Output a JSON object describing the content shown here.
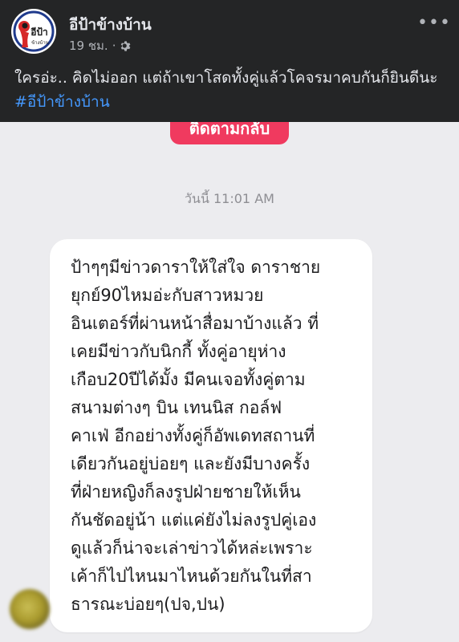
{
  "post": {
    "page_name": "อีป้าข้างบ้าน",
    "avatar_text": "อีป้า",
    "avatar_subtext": "ข้างบ้าน",
    "time": "19 ชม.",
    "dot": "·",
    "audience_icon": "gear-icon",
    "more_icon": "more-horizontal-icon",
    "more_label": "•••",
    "caption_text": "ใครอ่ะ.. คิดไม่ออก แต่ถ้าเขาโสดทั้งคู่แล้วโคจรมาคบกันก็ยินดีนะ ",
    "hashtag": "#อีป้าข้างบ้าน"
  },
  "chat": {
    "follow_label": "ติดตามกลับ",
    "timestamp": "วันนี้ 11:01 AM",
    "message_lines": [
      "ป้าๆๆมีข่าวดาราให้ใส่ใจ ดาราชาย",
      "ยุกย์90ไหมอ่ะกับสาวหมวย",
      "อินเตอร์ที่ผ่านหน้าสื่อมาบ้างแล้ว ที่",
      "เคยมีข่าวกับนิกกี้ ทั้งคู่อายุห่าง",
      "เกือบ20ปีได้มั้ง มีคนเจอทั้งคู่ตาม",
      "สนามต่างๆ บิน เทนนิส กอล์ฟ",
      "คาเฟ่ อีกอย่างทั้งคู่ก็อัพเดทสถานที่",
      "เดียวกันอยู่บ่อยๆ และยังมีบางครั้ง",
      "ที่ฝ่ายหญิงก็ลงรูปฝ่ายชายให้เห็น",
      "กันชัดอยู่น้า แต่แค่ยังไม่ลงรูปคู่เอง",
      "ดูแล้วก็น่าจะเล่าข่าวได้หล่ะเพราะ",
      "เค้าก็ไปไหนมาไหนด้วยกันในที่สา",
      "ธารณะบ่อยๆ(ปจ,ปน)"
    ]
  },
  "colors": {
    "header_bg": "#242526",
    "hashtag": "#4599ff",
    "follow_button": "#f03a5f",
    "chat_bg": "#ececef"
  }
}
